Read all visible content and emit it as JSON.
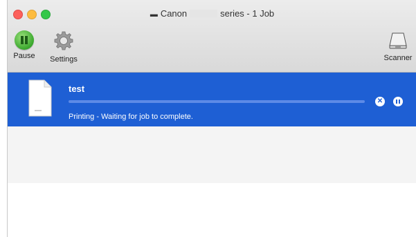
{
  "window": {
    "title_prefix": "Canon",
    "title_suffix": "series - 1 Job"
  },
  "toolbar": {
    "pause_label": "Pause",
    "settings_label": "Settings",
    "scanner_label": "Scanner"
  },
  "job": {
    "name": "test",
    "status": "Printing - Waiting for job to complete.",
    "progress": 0.0
  },
  "icons": {
    "close": "close-window-icon",
    "minimize": "minimize-window-icon",
    "maximize": "maximize-window-icon",
    "pause": "pause-icon",
    "settings": "gear-icon",
    "scanner": "scanner-icon",
    "document": "document-icon",
    "cancel_job": "cancel-job-icon",
    "hold_job": "hold-job-icon"
  },
  "colors": {
    "selection": "#1e5fd4",
    "pause_green": "#3aa82d"
  }
}
